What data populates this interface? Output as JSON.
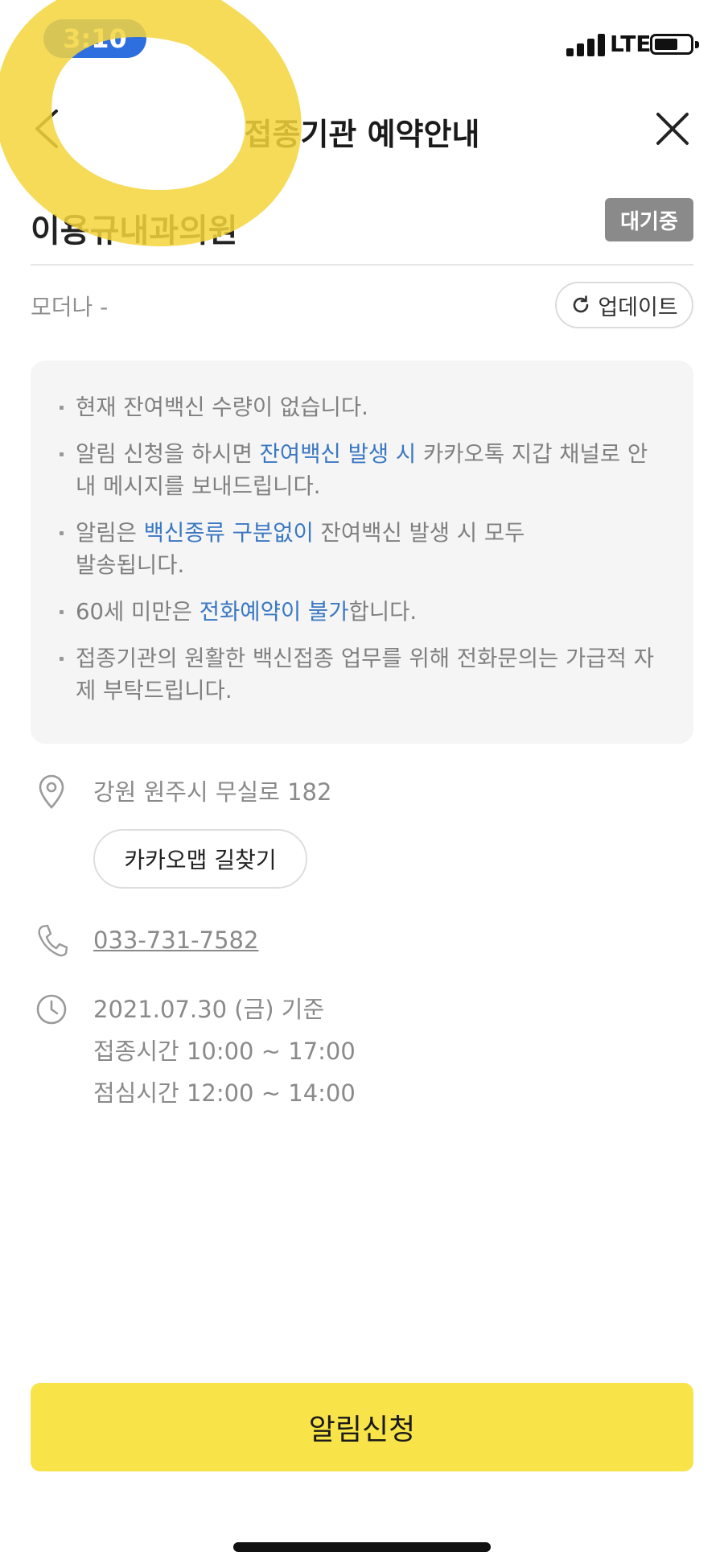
{
  "status_bar": {
    "time": "3:10",
    "network": "LTE",
    "time_pill_color": "#2e6fe0"
  },
  "header": {
    "title": "접종기관 예약안내",
    "back_icon": "chevron-left-icon",
    "close_icon": "close-icon"
  },
  "clinic": {
    "name": "이용규내과의원",
    "status_badge": "대기중"
  },
  "vaccine": {
    "name": "모더나 -",
    "update_label": "업데이트",
    "update_icon": "refresh-icon"
  },
  "notice": {
    "item1": "현재 잔여백신 수량이 없습니다.",
    "item2_pre": "알림 신청을 하시면 ",
    "item2_hl": "잔여백신 발생 시",
    "item2_post": " 카카오톡 지갑 채널로 안내 메시지를 보내드립니다.",
    "item3_pre": "알림은 ",
    "item3_hl": "백신종류 구분없이",
    "item3_post": " 잔여백신 발생 시 모두",
    "item3_line2": "발송됩니다.",
    "item4_pre": "60세 미만은 ",
    "item4_hl": "전화예약이 불가",
    "item4_post": "합니다.",
    "item5": "접종기관의 원활한 백신접종 업무를 위해 전화문의는 가급적 자제 부탁드립니다.",
    "highlight_color": "#3a78c2"
  },
  "info": {
    "address": "강원 원주시 무실로 182",
    "map_button": "카카오맵 길찾기",
    "phone": "033-731-7582",
    "date_line": "2021.07.30 (금) 기준",
    "hours_line": "접종시간 10:00 ~ 17:00",
    "lunch_line": "점심시간 12:00 ~ 14:00",
    "icons": [
      "location-pin-icon",
      "phone-icon",
      "clock-icon"
    ]
  },
  "footer": {
    "notify_button": "알림신청",
    "button_color": "#f8e448"
  }
}
